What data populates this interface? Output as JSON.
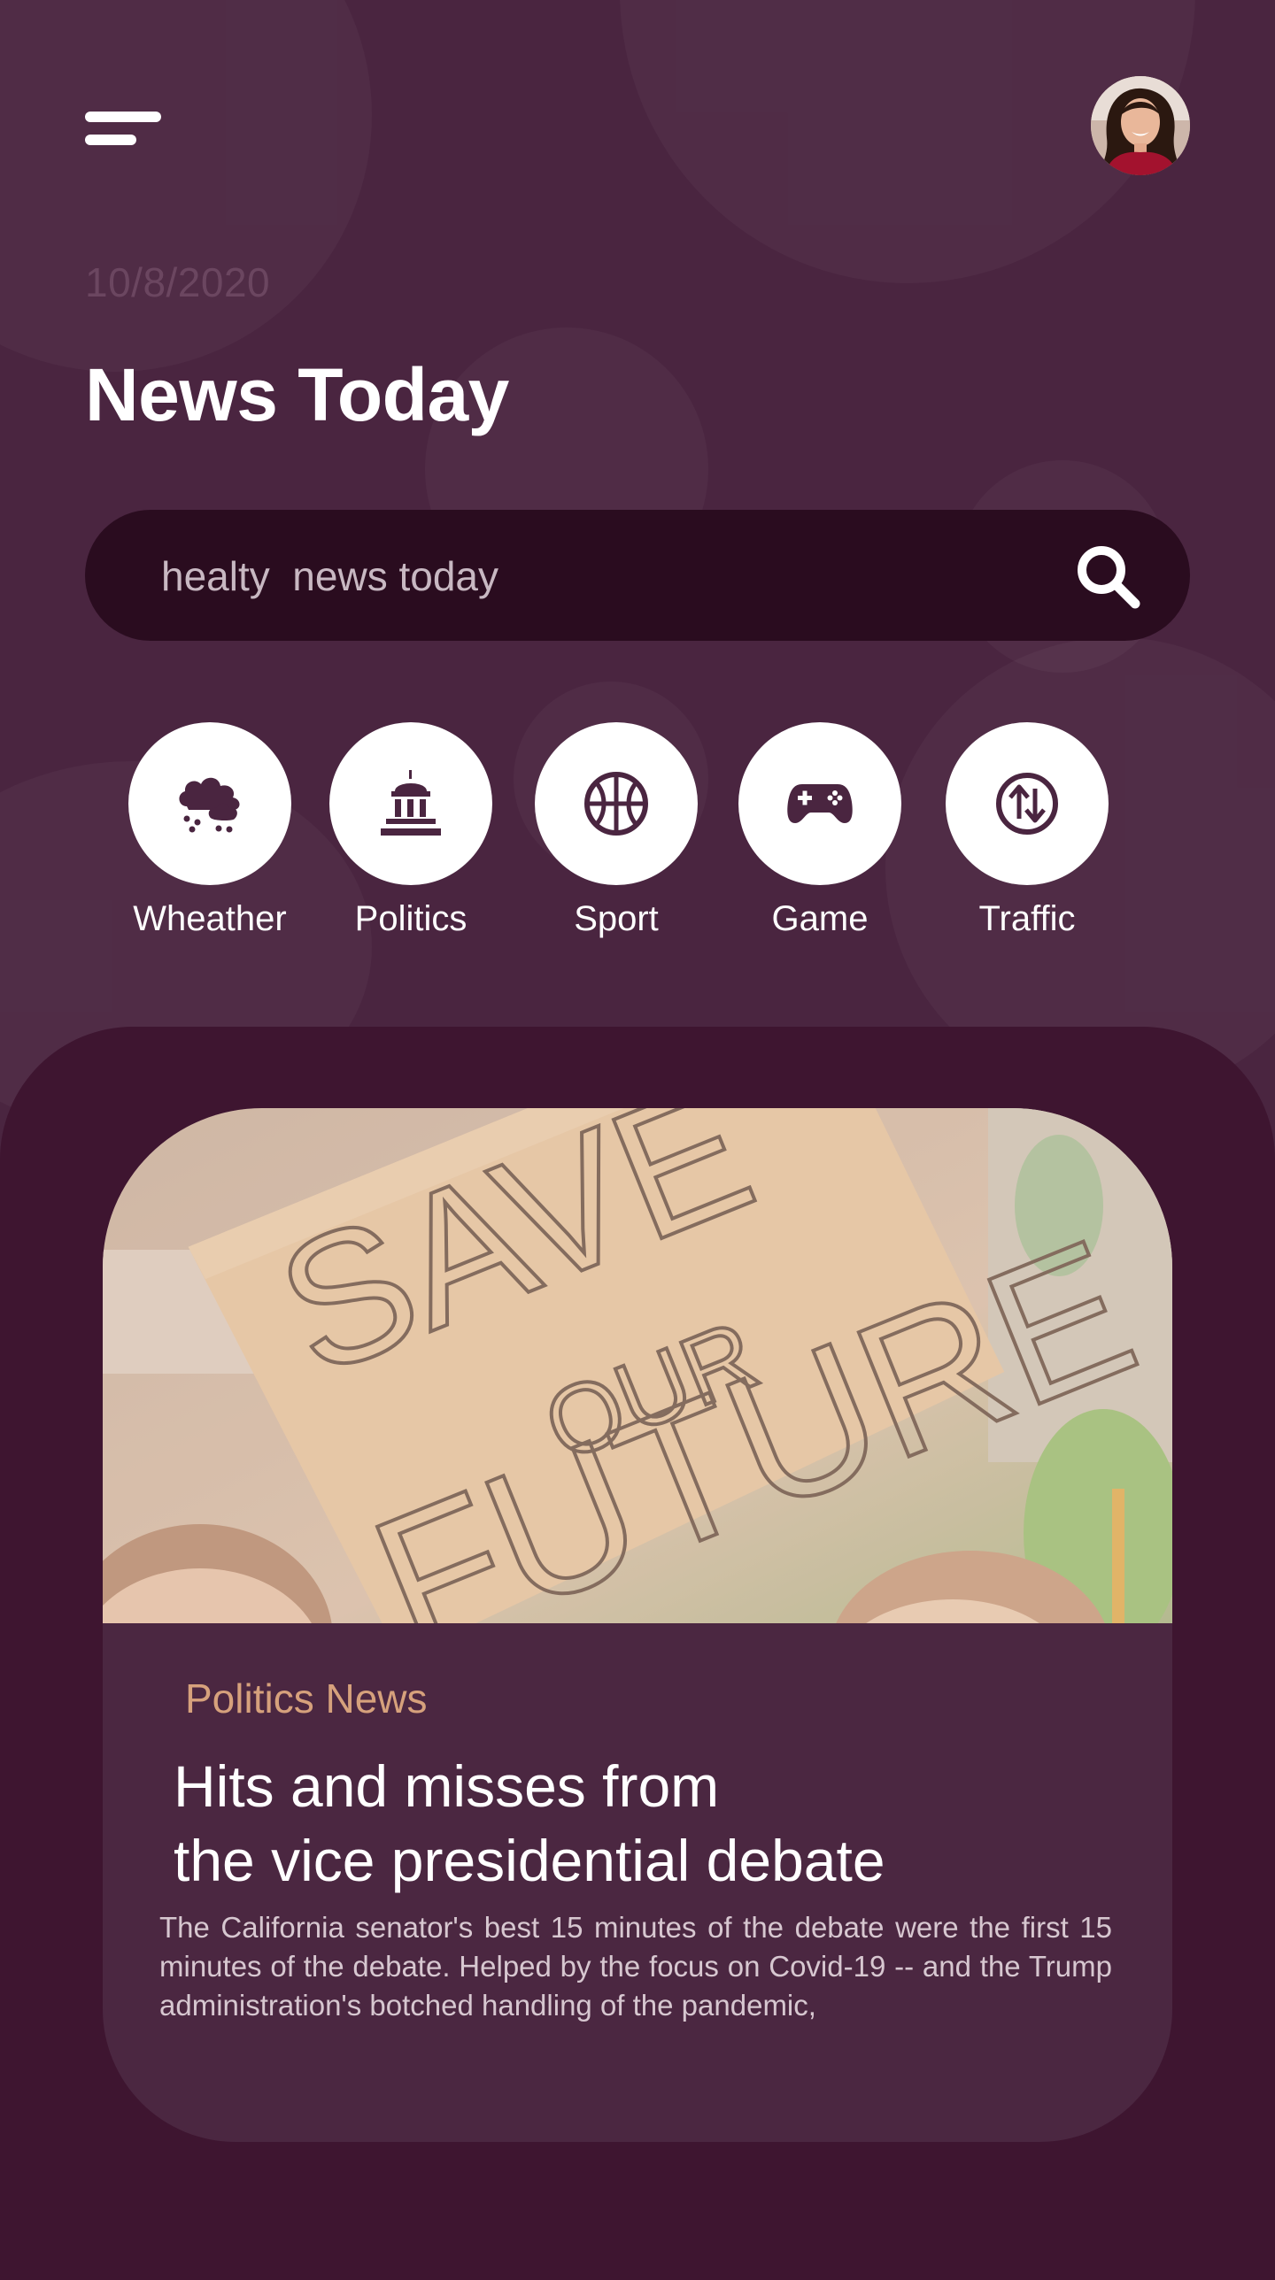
{
  "header": {
    "date": "10/8/2020",
    "title": "News Today"
  },
  "search": {
    "value": "healty  news today",
    "placeholder": "healty  news today"
  },
  "categories": [
    {
      "label": "Wheather",
      "icon": "cloud-rain-icon"
    },
    {
      "label": "Politics",
      "icon": "capitol-building-icon"
    },
    {
      "label": "Sport",
      "icon": "basketball-icon"
    },
    {
      "label": "Game",
      "icon": "gamepad-icon"
    },
    {
      "label": "Traffic",
      "icon": "up-down-arrows-icon"
    }
  ],
  "article": {
    "category": "Politics News",
    "title_line1": "Hits and misses from",
    "title_line2": "the vice presidential debate",
    "summary": "The California senator's best 15 minutes of the debate were the first 15 minutes of the debate. Helped by the focus on Covid-19 -- and the Trump administration's botched handling of the pandemic,",
    "image_text": {
      "line1": "SAVE",
      "line2": "OUR",
      "line3": "FUTURE"
    }
  },
  "colors": {
    "background": "#4a2540",
    "panel": "#3e1530",
    "card": "#4b2741",
    "search_bg": "#2a0c1f",
    "accent": "#d6a17c",
    "icon": "#4a2540"
  }
}
